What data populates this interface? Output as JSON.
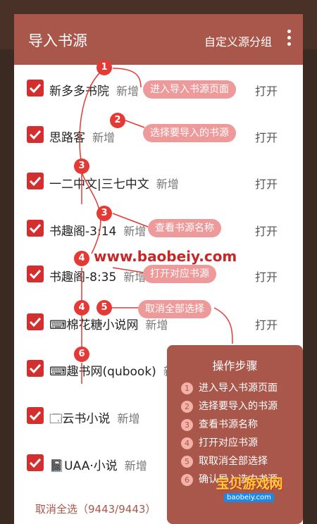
{
  "header": {
    "title": "导入书源",
    "group_label": "自定义源分组"
  },
  "rows": [
    {
      "name": "新多多书院",
      "tag": "新增",
      "action": "打开"
    },
    {
      "name": "思路客",
      "tag": "新增",
      "action": "打开"
    },
    {
      "name": "一二中文|三七中文",
      "tag": "新增",
      "action": "打开"
    },
    {
      "name": "书趣阁-3:14",
      "tag": "新增",
      "action": "打开"
    },
    {
      "name": "书趣阁-8:35",
      "tag": "新增",
      "action": "打开"
    },
    {
      "name": "⌨棉花糖小说网",
      "tag": "新增",
      "action": "打开"
    },
    {
      "name": "⌨趣书网(qubook)",
      "tag": "新增",
      "action": ""
    },
    {
      "name": "🗔云书小说",
      "tag": "新增",
      "action": "打开"
    },
    {
      "name": "📓UAA·小说",
      "tag": "新增",
      "action": "打开"
    }
  ],
  "footer": {
    "cancel_all": "取消全选（9443/9443）"
  },
  "annotations": {
    "pills": [
      "进入导入书源页面",
      "选择要导入的书源",
      "查看书源名称",
      "打开对应书源",
      "取消全部选择"
    ],
    "numbers": [
      "1",
      "2",
      "3",
      "3",
      "4",
      "4",
      "5",
      "6"
    ],
    "watermark": "www.baobeiy.com"
  },
  "steps_panel": {
    "title": "操作步骤",
    "items": [
      {
        "n": "1",
        "text": "进入导入书源页面"
      },
      {
        "n": "2",
        "text": "选择要导入的书源"
      },
      {
        "n": "3",
        "text": "查看书源名称"
      },
      {
        "n": "4",
        "text": "打开对应书源"
      },
      {
        "n": "5",
        "text": "取取消全部选择"
      },
      {
        "n": "6",
        "text": "确认导入选中书源"
      }
    ]
  },
  "logo": {
    "text": "宝贝游戏网",
    "url": "baobeiy.com"
  },
  "colors": {
    "header": "#a9574a",
    "checkbox": "#d32f2f",
    "pill": "#ef9a9a",
    "badge": "#e53935"
  }
}
